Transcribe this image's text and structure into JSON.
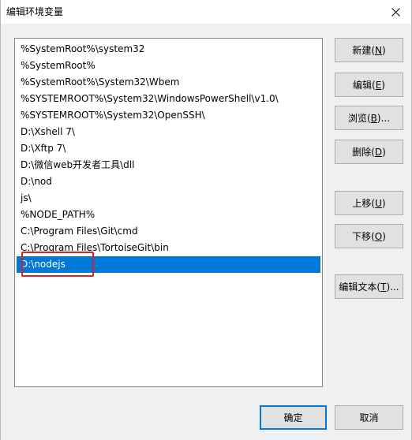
{
  "window": {
    "title": "编辑环境变量"
  },
  "list": {
    "items": [
      "%SystemRoot%\\system32",
      "%SystemRoot%",
      "%SystemRoot%\\System32\\Wbem",
      "%SYSTEMROOT%\\System32\\WindowsPowerShell\\v1.0\\",
      "%SYSTEMROOT%\\System32\\OpenSSH\\",
      "D:\\Xshell 7\\",
      "D:\\Xftp 7\\",
      "D:\\微信web开发者工具\\dll",
      "D:\\nod",
      "js\\",
      "%NODE_PATH%",
      "C:\\Program Files\\Git\\cmd",
      "C:\\Program Files\\TortoiseGit\\bin",
      "D:\\nodejs"
    ],
    "selected_index": 13
  },
  "buttons": {
    "new": {
      "label": "新建(",
      "key": "N",
      "suffix": ")"
    },
    "edit": {
      "label": "编辑(",
      "key": "E",
      "suffix": ")"
    },
    "browse": {
      "label": "浏览(",
      "key": "B",
      "suffix": ")..."
    },
    "delete": {
      "label": "删除(",
      "key": "D",
      "suffix": ")"
    },
    "move_up": {
      "label": "上移(",
      "key": "U",
      "suffix": ")"
    },
    "move_down": {
      "label": "下移(",
      "key": "O",
      "suffix": ")"
    },
    "edit_text": {
      "label": "编辑文本(",
      "key": "T",
      "suffix": ")..."
    },
    "ok": {
      "label": "确定"
    },
    "cancel": {
      "label": "取消"
    }
  },
  "colors": {
    "selection": "#0078d7",
    "highlight_box": "#e02020"
  }
}
